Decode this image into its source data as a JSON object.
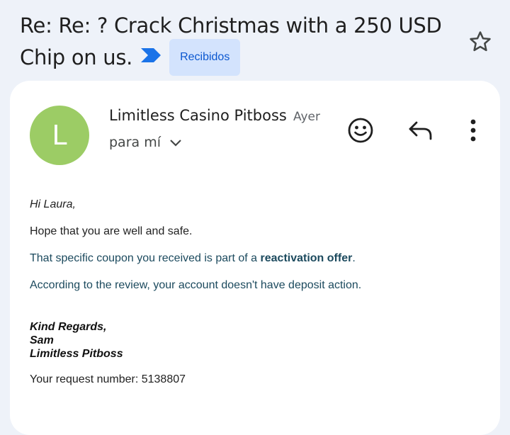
{
  "email": {
    "subject": "Re: Re: ? Crack Christmas with a 250 USD Chip on us.",
    "label": "Recibidos",
    "sender": "Limitless Casino Pitboss",
    "date": "Ayer",
    "recipient": "para mí",
    "avatar_letter": "L"
  },
  "body": {
    "greeting": "Hi Laura,",
    "line1": "Hope that you are well and safe.",
    "line2_prefix": "That specific coupon you received is part of a ",
    "line2_bold": "reactivation offer",
    "line2_suffix": ".",
    "line3": "According to the review, your account doesn't have deposit action.",
    "sig_line1": "Kind Regards,",
    "sig_line2": "Sam",
    "sig_line3": "Limitless Pitboss",
    "request_label": "Your request number: 5138807"
  },
  "icons": {
    "star": "star-outline-icon",
    "important": "important-marker-icon",
    "emoji": "emoji-reaction-icon",
    "reply": "reply-icon",
    "more": "more-vert-icon",
    "expand": "chevron-down-icon"
  },
  "colors": {
    "background": "#eef2f9",
    "avatar": "#9ccc65",
    "label_bg": "#d3e3fd",
    "label_text": "#0b57d0",
    "important_marker": "#1a73e8",
    "body_teal": "#1c4a5e"
  }
}
